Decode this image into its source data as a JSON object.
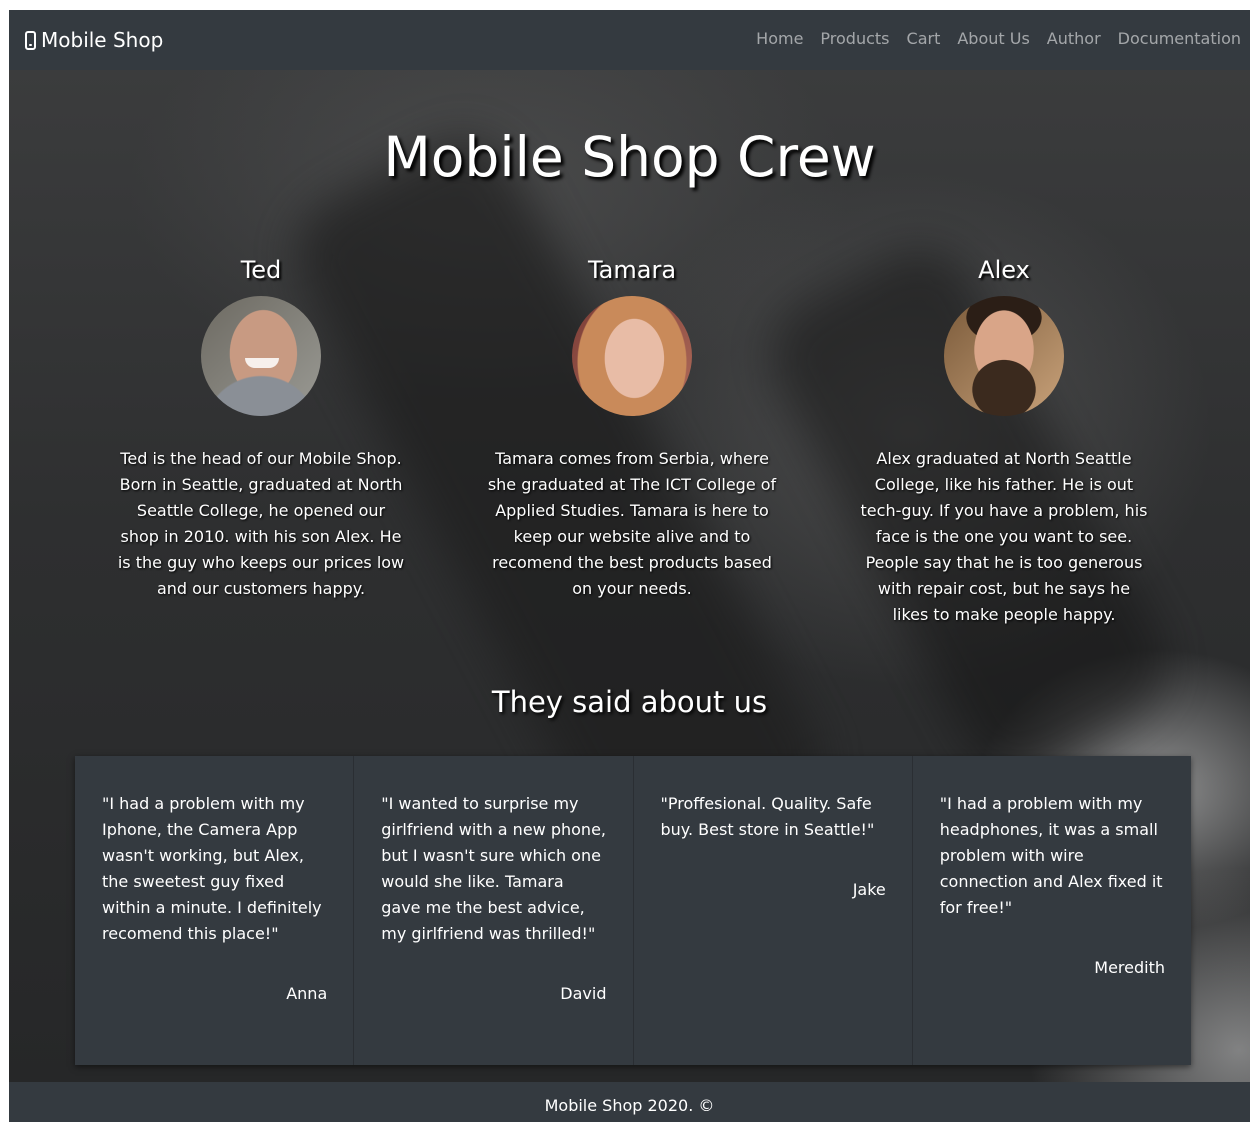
{
  "navbar": {
    "brand": "Mobile Shop",
    "links": [
      "Home",
      "Products",
      "Cart",
      "About Us",
      "Author",
      "Documentation"
    ]
  },
  "page_title": "Mobile Shop Crew",
  "team": [
    {
      "name": "Ted",
      "bio": "Ted is the head of our Mobile Shop. Born in Seattle, graduated at North Seattle College, he opened our shop in 2010. with his son Alex. He is the guy who keeps our prices low and our customers happy."
    },
    {
      "name": "Tamara",
      "bio": "Tamara comes from Serbia, where she graduated at The ICT College of Applied Studies. Tamara is here to keep our website alive and to recomend the best products based on your needs."
    },
    {
      "name": "Alex",
      "bio": "Alex graduated at North Seattle College, like his father. He is out tech-guy. If you have a problem, his face is the one you want to see. People say that he is too generous with repair cost, but he says he likes to make people happy."
    }
  ],
  "testimonials_title": "They said about us",
  "testimonials": [
    {
      "quote": "\"I had a problem with my Iphone, the Camera App wasn't working, but Alex, the sweetest guy fixed within a minute. I definitely recomend this place!\"",
      "author": "Anna"
    },
    {
      "quote": "\"I wanted to surprise my girlfriend with a new phone, but I wasn't sure which one would she like. Tamara gave me the best advice, my girlfriend was thrilled!\"",
      "author": "David"
    },
    {
      "quote": "\"Proffesional. Quality. Safe buy. Best store in Seattle!\"",
      "author": "Jake"
    },
    {
      "quote": "\"I had a problem with my headphones, it was a small problem with wire connection and Alex fixed it for free!\"",
      "author": "Meredith"
    }
  ],
  "footer": {
    "text": "Mobile Shop 2020. ©"
  },
  "colors": {
    "navbar": "#343a40",
    "card": "#343a40",
    "nav_link": "rgba(255,255,255,0.55)",
    "text": "#ffffff"
  }
}
